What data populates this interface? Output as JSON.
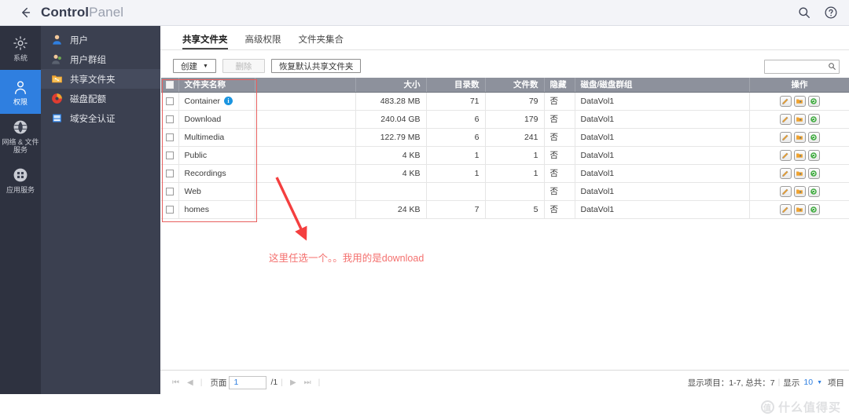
{
  "window": {
    "title_strong": "Control",
    "title_light": "Panel",
    "back_icon": "back-arrow-icon",
    "search_icon": "search-icon",
    "help_icon": "help-icon"
  },
  "rail": {
    "items": [
      {
        "label": "系统",
        "icon": "gear-icon",
        "active": false
      },
      {
        "label": "权限",
        "icon": "user-icon",
        "active": true
      },
      {
        "label": "网络 & 文件\n服务",
        "icon": "globe-icon",
        "active": false
      },
      {
        "label": "应用服务",
        "icon": "apps-grid-icon",
        "active": false
      }
    ]
  },
  "sidebar": {
    "items": [
      {
        "label": "用户",
        "icon": "user-blue-icon",
        "active": false
      },
      {
        "label": "用户群组",
        "icon": "user-group-icon",
        "active": false
      },
      {
        "label": "共享文件夹",
        "icon": "shared-folder-icon",
        "active": true
      },
      {
        "label": "磁盘配额",
        "icon": "disk-quota-icon",
        "active": false
      },
      {
        "label": "域安全认证",
        "icon": "domain-security-icon",
        "active": false
      }
    ]
  },
  "tabs": [
    {
      "label": "共享文件夹",
      "active": true
    },
    {
      "label": "高级权限",
      "active": false
    },
    {
      "label": "文件夹集合",
      "active": false
    }
  ],
  "toolbar": {
    "create_label": "创建",
    "create_caret": "▼",
    "delete_label": "删除",
    "restore_label": "恢复默认共享文件夹",
    "search_value": "",
    "search_placeholder": "",
    "search_icon": "search-icon"
  },
  "table": {
    "columns": [
      {
        "key": "check",
        "label": ""
      },
      {
        "key": "name",
        "label": "文件夹名称"
      },
      {
        "key": "spacer",
        "label": ""
      },
      {
        "key": "size",
        "label": "大小"
      },
      {
        "key": "dirs",
        "label": "目录数"
      },
      {
        "key": "files",
        "label": "文件数"
      },
      {
        "key": "hidden",
        "label": "隐藏"
      },
      {
        "key": "volume",
        "label": "磁盘/磁盘群组"
      },
      {
        "key": "actions",
        "label": "操作"
      }
    ],
    "action_icons": [
      "edit-pencil-icon",
      "folder-permission-icon",
      "refresh-icon"
    ],
    "rows": [
      {
        "name": "Container",
        "badge": "i",
        "size": "483.28 MB",
        "dirs": "71",
        "files": "79",
        "hidden": "否",
        "volume": "DataVol1"
      },
      {
        "name": "Download",
        "badge": "",
        "size": "240.04 GB",
        "dirs": "6",
        "files": "179",
        "hidden": "否",
        "volume": "DataVol1"
      },
      {
        "name": "Multimedia",
        "badge": "",
        "size": "122.79 MB",
        "dirs": "6",
        "files": "241",
        "hidden": "否",
        "volume": "DataVol1"
      },
      {
        "name": "Public",
        "badge": "",
        "size": "4 KB",
        "dirs": "1",
        "files": "1",
        "hidden": "否",
        "volume": "DataVol1"
      },
      {
        "name": "Recordings",
        "badge": "",
        "size": "4 KB",
        "dirs": "1",
        "files": "1",
        "hidden": "否",
        "volume": "DataVol1"
      },
      {
        "name": "Web",
        "badge": "",
        "size": "",
        "dirs": "",
        "files": "",
        "hidden": "否",
        "volume": "DataVol1"
      },
      {
        "name": "homes",
        "badge": "",
        "size": "24 KB",
        "dirs": "7",
        "files": "5",
        "hidden": "否",
        "volume": "DataVol1"
      }
    ]
  },
  "pager": {
    "first_icon": "first-page-icon",
    "prev_icon": "prev-page-icon",
    "next_icon": "next-page-icon",
    "last_icon": "last-page-icon",
    "page_label": "页面",
    "page_value": "1",
    "total_pages": "/1",
    "showing_text": "显示项目：1-7, 总共：7",
    "divider": "|",
    "show_label": "显示",
    "page_size": "10",
    "page_size_caret": "▼",
    "items_label": "项目"
  },
  "annotations": {
    "note_text": "这里任选一个。。我用的是download",
    "rect_color": "#e8605f",
    "arrow_color": "#f43f3f",
    "text_color": "#f4716f"
  },
  "watermark": {
    "mark": "值",
    "text": "什么值得买"
  }
}
